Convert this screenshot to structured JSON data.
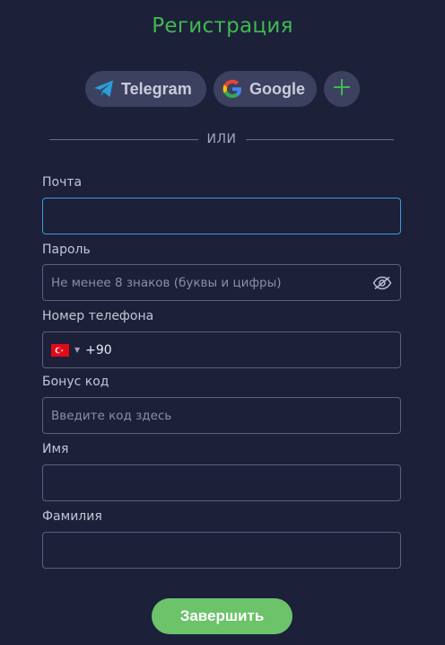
{
  "title": "Регистрация",
  "social": {
    "telegram_label": "Telegram",
    "google_label": "Google",
    "more_icon": "plus-icon"
  },
  "divider_text": "ИЛИ",
  "fields": {
    "email": {
      "label": "Почта",
      "value": "",
      "placeholder": ""
    },
    "password": {
      "label": "Пароль",
      "value": "",
      "placeholder": "Не менее 8 знаков (буквы и цифры)"
    },
    "phone": {
      "label": "Номер телефона",
      "country_code": "+90",
      "value": "",
      "placeholder": ""
    },
    "bonus": {
      "label": "Бонус код",
      "value": "",
      "placeholder": "Введите код здесь"
    },
    "first_name": {
      "label": "Имя",
      "value": "",
      "placeholder": ""
    },
    "last_name": {
      "label": "Фамилия",
      "value": "",
      "placeholder": ""
    }
  },
  "submit_label": "Завершить",
  "colors": {
    "background": "#1d2039",
    "accent_green": "#3fb950",
    "button_green": "#6cc36a",
    "focus_blue": "#3c9bde",
    "chip_bg": "#3d4160"
  }
}
